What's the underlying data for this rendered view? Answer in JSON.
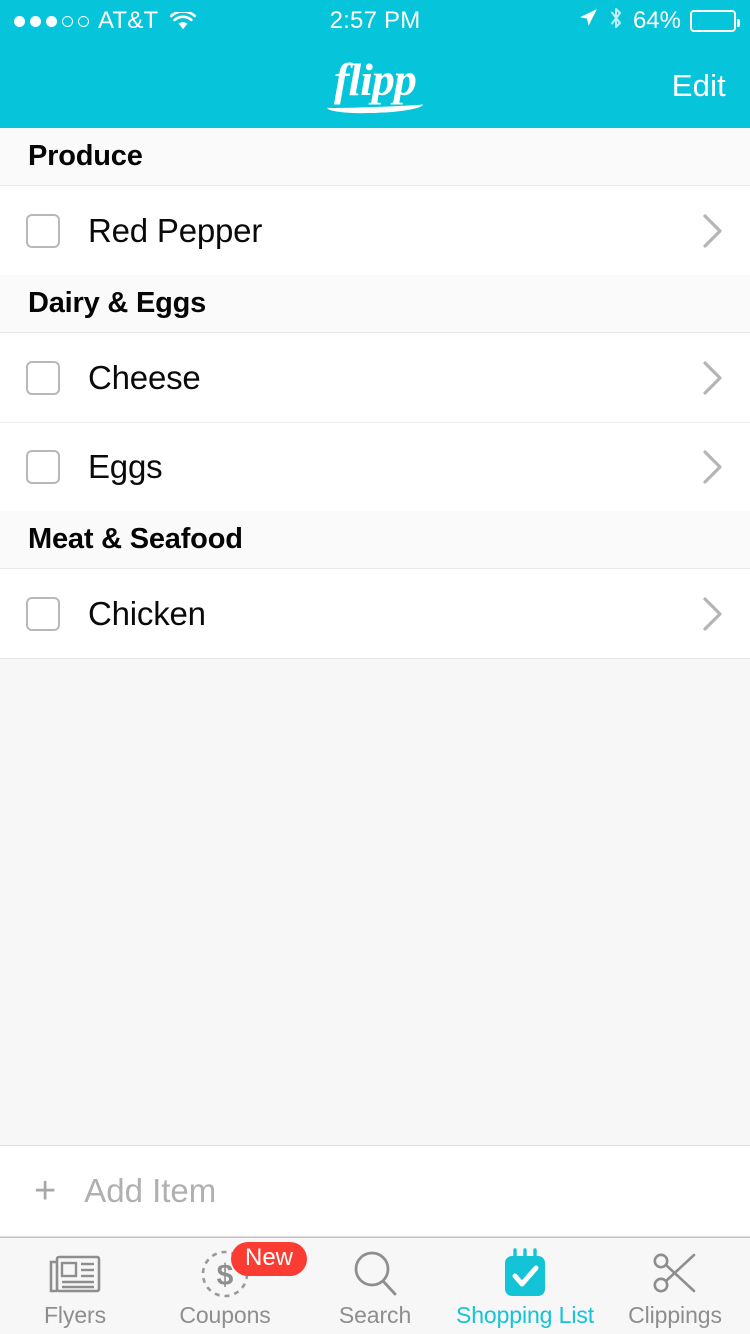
{
  "status_bar": {
    "carrier": "AT&T",
    "signal_dots_filled": 3,
    "signal_dots_total": 5,
    "wifi_icon": "wifi-icon",
    "time": "2:57 PM",
    "location_icon": "location-arrow-icon",
    "bluetooth_icon": "bluetooth-icon",
    "battery_percent": "64%",
    "battery_level": 64
  },
  "nav": {
    "logo_text": "flipp",
    "edit_label": "Edit"
  },
  "theme": {
    "accent": "#06C4D9",
    "badge_red": "#FA3C32",
    "active_tab": "#13C3D6",
    "section_bg": "#FAFAFA",
    "page_bg": "#F7F7F7"
  },
  "list": {
    "sections": [
      {
        "title": "Produce",
        "items": [
          {
            "label": "Red Pepper",
            "checked": false
          }
        ]
      },
      {
        "title": "Dairy & Eggs",
        "items": [
          {
            "label": "Cheese",
            "checked": false
          },
          {
            "label": "Eggs",
            "checked": false
          }
        ]
      },
      {
        "title": "Meat & Seafood",
        "items": [
          {
            "label": "Chicken",
            "checked": false
          }
        ]
      }
    ]
  },
  "add_item": {
    "plus": "+",
    "placeholder": "Add Item",
    "value": ""
  },
  "tabbar": {
    "tabs": [
      {
        "label": "Flyers",
        "icon": "newspaper-icon",
        "active": false,
        "badge": null
      },
      {
        "label": "Coupons",
        "icon": "dollar-coupon-icon",
        "active": false,
        "badge": "New"
      },
      {
        "label": "Search",
        "icon": "magnifier-icon",
        "active": false,
        "badge": null
      },
      {
        "label": "Shopping List",
        "icon": "notepad-check-icon",
        "active": true,
        "badge": null
      },
      {
        "label": "Clippings",
        "icon": "scissors-icon",
        "active": false,
        "badge": null
      }
    ]
  }
}
